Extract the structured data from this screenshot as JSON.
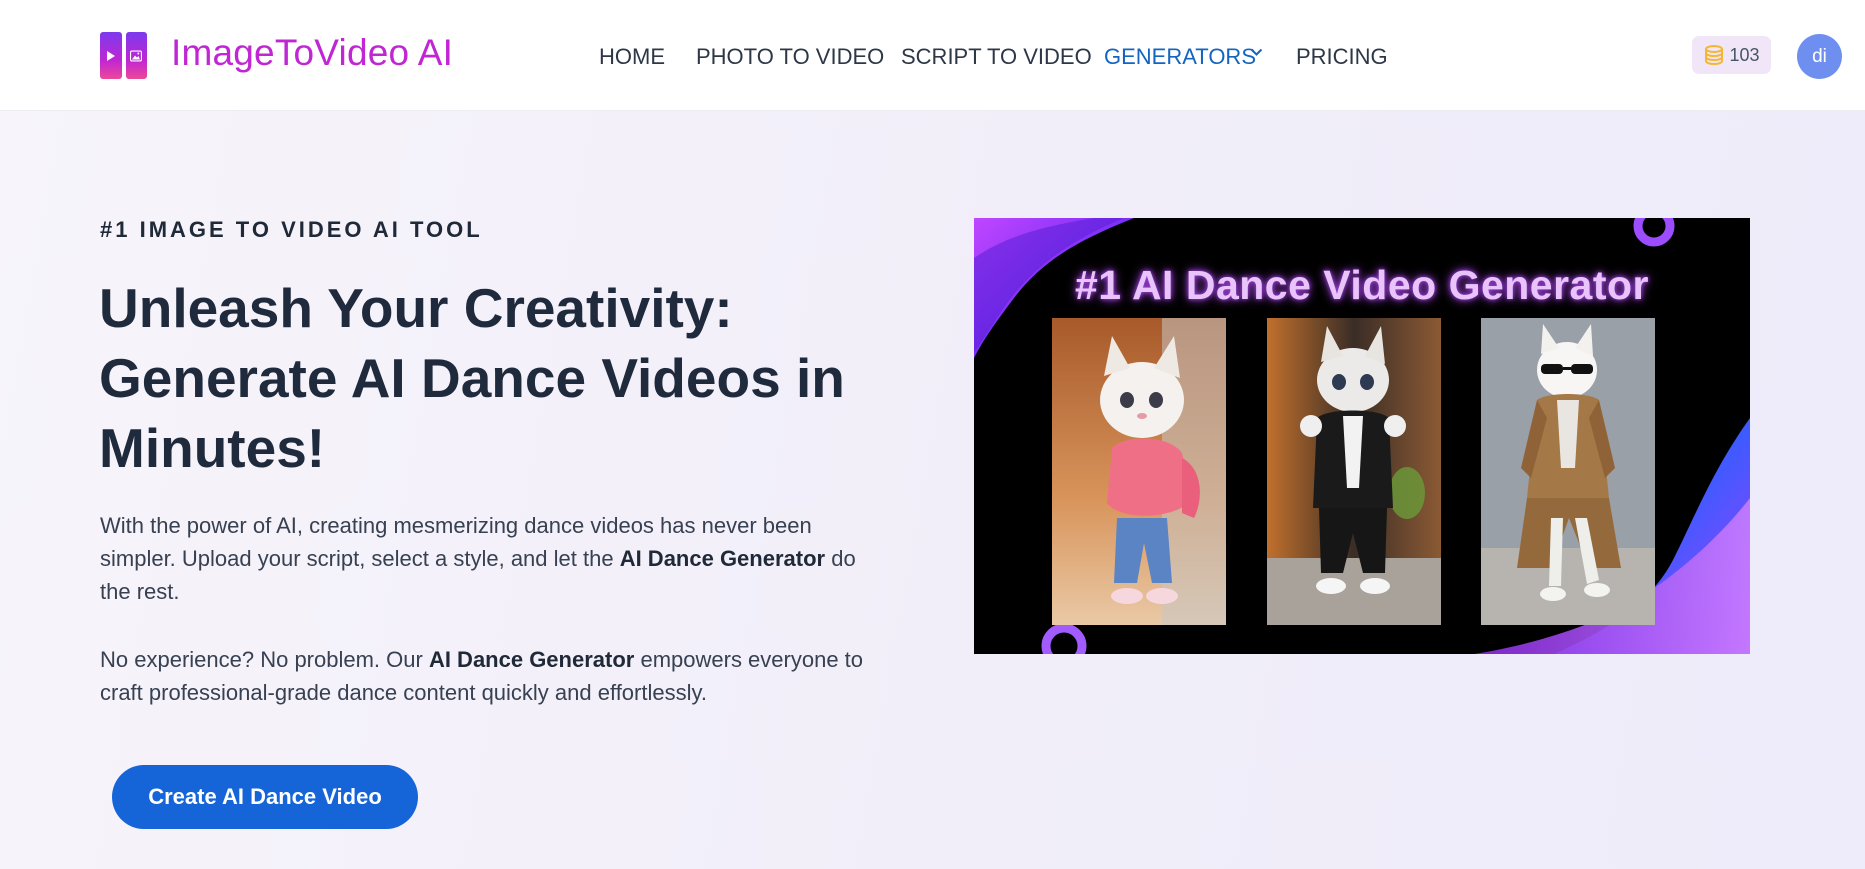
{
  "brand": {
    "name": "ImageToVideo AI"
  },
  "nav": {
    "items": [
      {
        "label": "HOME"
      },
      {
        "label": "PHOTO TO VIDEO"
      },
      {
        "label": "SCRIPT TO VIDEO"
      },
      {
        "label": "GENERATORS"
      },
      {
        "label": "PRICING"
      }
    ],
    "active": "GENERATORS"
  },
  "user": {
    "credits": "103",
    "avatar_initials": "di"
  },
  "hero": {
    "eyebrow": "#1 IMAGE TO VIDEO AI TOOL",
    "headline_line1": "Unleash Your Creativity:",
    "headline_line2": "Generate AI Dance Videos in",
    "headline_line3": "Minutes!",
    "para1_part1": "With the power of AI, creating mesmerizing dance videos has never been simpler. Upload your script, select a style, and let the ",
    "para1_bold": "AI Dance Generator",
    "para1_part2": " do the rest.",
    "para2_part1": "No experience? No problem. Our ",
    "para2_bold": "AI Dance Generator",
    "para2_part2": " empowers everyone to craft professional-grade dance content quickly and effortlessly.",
    "cta_label": "Create AI Dance Video",
    "image_title": "#1 AI Dance Video Generator"
  },
  "icons": {
    "logo": "play-and-image-logo-icon",
    "credits": "coins-icon",
    "dropdown": "chevron-down-icon"
  },
  "colors": {
    "brand": "#c026d3",
    "nav_active": "#1565c0",
    "cta": "#1565d8",
    "avatar": "#6f8ff0",
    "credits_bg": "#f0e6f7",
    "coin": "#f5b731"
  }
}
